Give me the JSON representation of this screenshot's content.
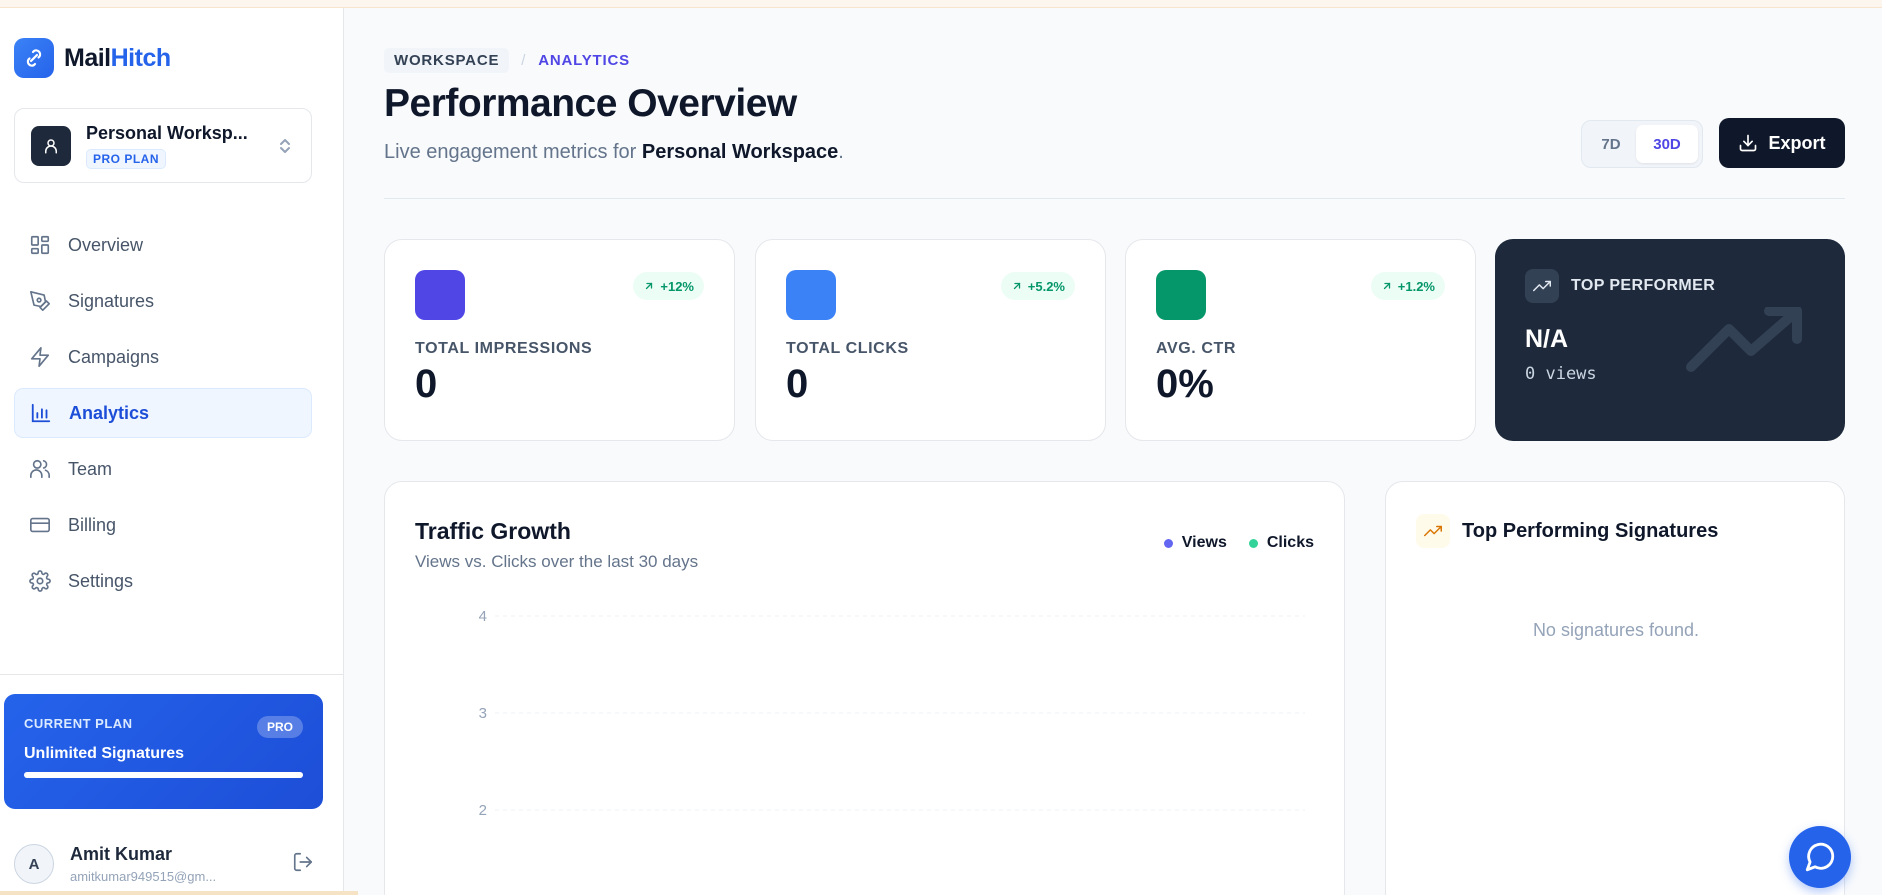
{
  "brand": {
    "part1": "Mail",
    "part2": "Hitch"
  },
  "workspace": {
    "name": "Personal Worksp...",
    "plan": "PRO PLAN"
  },
  "nav": [
    {
      "label": "Overview",
      "icon": "grid-icon",
      "active": false
    },
    {
      "label": "Signatures",
      "icon": "pen-tool-icon",
      "active": false
    },
    {
      "label": "Campaigns",
      "icon": "zap-icon",
      "active": false
    },
    {
      "label": "Analytics",
      "icon": "bar-chart-icon",
      "active": true
    },
    {
      "label": "Team",
      "icon": "users-icon",
      "active": false
    },
    {
      "label": "Billing",
      "icon": "credit-card-icon",
      "active": false
    },
    {
      "label": "Settings",
      "icon": "gear-icon",
      "active": false
    }
  ],
  "plan": {
    "label": "CURRENT PLAN",
    "badge": "PRO",
    "title": "Unlimited Signatures",
    "progress": 1.0
  },
  "user": {
    "initial": "A",
    "name": "Amit Kumar",
    "email": "amitkumar949515@gm..."
  },
  "breadcrumb": {
    "root": "WORKSPACE",
    "separator": "/",
    "current": "ANALYTICS"
  },
  "header": {
    "title": "Performance Overview",
    "subtitle_prefix": "Live engagement metrics for ",
    "subtitle_workspace": "Personal Workspace",
    "subtitle_suffix": "."
  },
  "range_toggle": {
    "options": [
      "7D",
      "30D"
    ],
    "selected": "30D"
  },
  "export_label": "Export",
  "stats": [
    {
      "label": "TOTAL IMPRESSIONS",
      "value": "0",
      "change": "+12%",
      "color": "#4f46e5"
    },
    {
      "label": "TOTAL CLICKS",
      "value": "0",
      "change": "+5.2%",
      "color": "#3b82f6"
    },
    {
      "label": "AVG. CTR",
      "value": "0%",
      "change": "+1.2%",
      "color": "#059669"
    }
  ],
  "top_performer": {
    "label": "TOP PERFORMER",
    "value": "N/A",
    "sub": "0 views"
  },
  "traffic": {
    "title": "Traffic Growth",
    "subtitle": "Views vs. Clicks over the last 30 days"
  },
  "chart_data": {
    "type": "line",
    "title": "Traffic Growth",
    "subtitle": "Views vs. Clicks over the last 30 days",
    "series": [
      {
        "name": "Views",
        "color": "#6366f1",
        "values": []
      },
      {
        "name": "Clicks",
        "color": "#34d399",
        "values": []
      }
    ],
    "y_ticks": [
      "4",
      "3",
      "2"
    ],
    "ylim": [
      0,
      4
    ],
    "grid": true,
    "legend": "top-right"
  },
  "top_signatures": {
    "title": "Top Performing Signatures",
    "empty": "No signatures found."
  },
  "colors": {
    "accent": "#4f46e5",
    "brand": "#2563eb",
    "dark": "#0f172a"
  }
}
